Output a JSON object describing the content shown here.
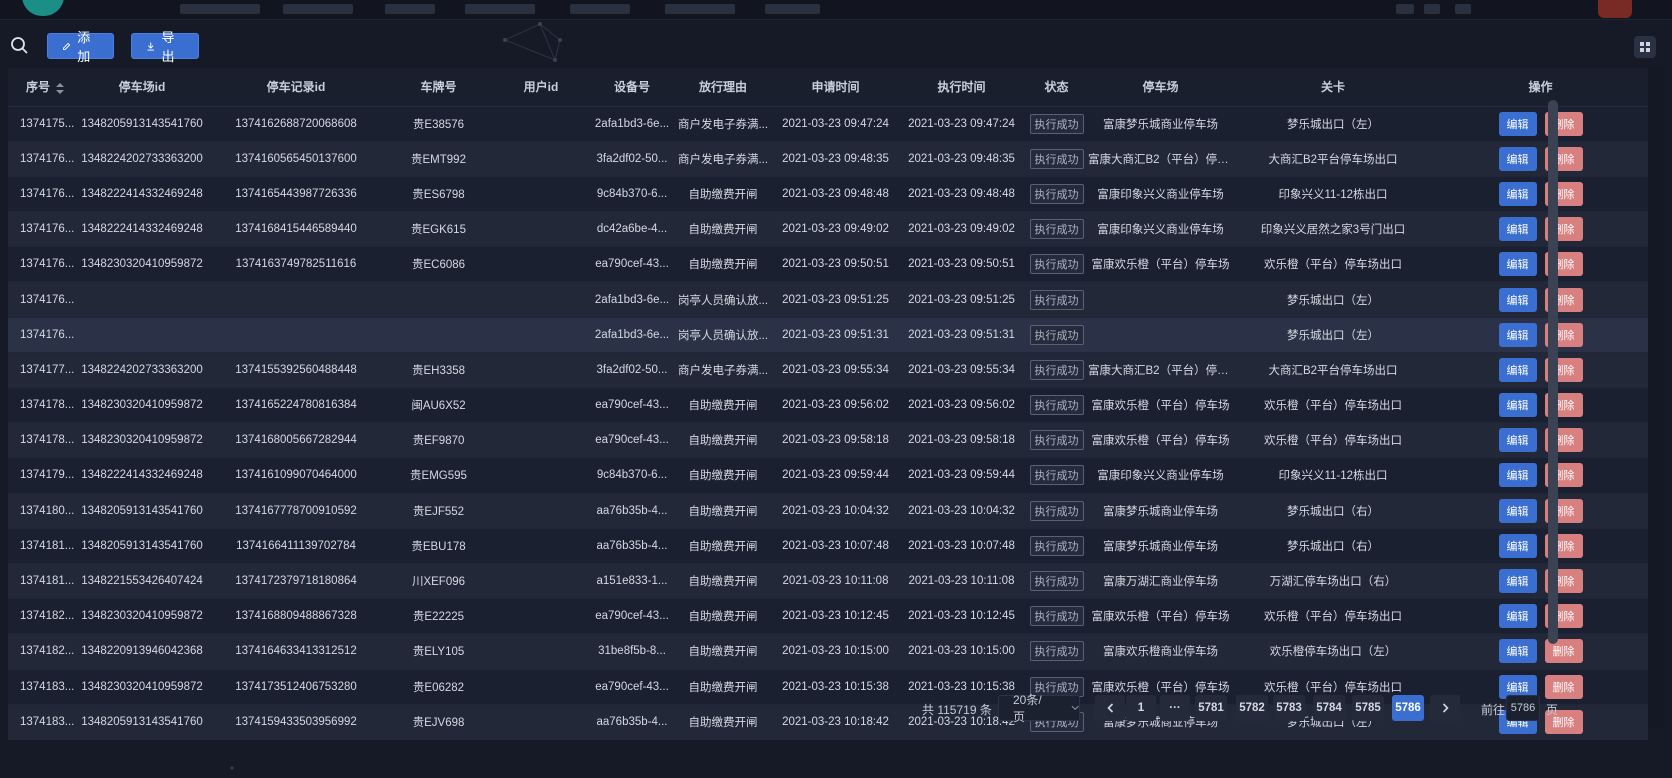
{
  "toolbar": {
    "add_label": "添加",
    "export_label": "导出"
  },
  "columns": [
    "序号",
    "停车场id",
    "停车记录id",
    "车牌号",
    "用户id",
    "设备号",
    "放行理由",
    "申请时间",
    "执行时间",
    "状态",
    "停车场",
    "关卡",
    "操作"
  ],
  "row_actions": {
    "edit": "编辑",
    "delete": "删除"
  },
  "rows": [
    [
      "1374175...",
      "1348205913143541760",
      "1374162688720068608",
      "贵E38576",
      "",
      "2afa1bd3-6e...",
      "商户发电子券满...",
      "2021-03-23 09:47:24",
      "2021-03-23 09:47:24",
      "执行成功",
      "富康梦乐城商业停车场",
      "梦乐城出口（左）"
    ],
    [
      "1374176...",
      "1348224202733363200",
      "1374160565450137600",
      "贵EMT992",
      "",
      "3fa2df02-50...",
      "商户发电子券满...",
      "2021-03-23 09:48:35",
      "2021-03-23 09:48:35",
      "执行成功",
      "富康大商汇B2（平台）停车场",
      "大商汇B2平台停车场出口"
    ],
    [
      "1374176...",
      "1348222414332469248",
      "1374165443987726336",
      "贵ES6798",
      "",
      "9c84b370-6...",
      "自助缴费开闸",
      "2021-03-23 09:48:48",
      "2021-03-23 09:48:48",
      "执行成功",
      "富康印象兴义商业停车场",
      "印象兴义11-12栋出口"
    ],
    [
      "1374176...",
      "1348222414332469248",
      "1374168415446589440",
      "贵EGK615",
      "",
      "dc42a6be-4...",
      "自助缴费开闸",
      "2021-03-23 09:49:02",
      "2021-03-23 09:49:02",
      "执行成功",
      "富康印象兴义商业停车场",
      "印象兴义居然之家3号门出口"
    ],
    [
      "1374176...",
      "1348230320410959872",
      "1374163749782511616",
      "贵EC6086",
      "",
      "ea790cef-43...",
      "自助缴费开闸",
      "2021-03-23 09:50:51",
      "2021-03-23 09:50:51",
      "执行成功",
      "富康欢乐橙（平台）停车场",
      "欢乐橙（平台）停车场出口"
    ],
    [
      "1374176...",
      "",
      "",
      "",
      "",
      "2afa1bd3-6e...",
      "岗亭人员确认放...",
      "2021-03-23 09:51:25",
      "2021-03-23 09:51:25",
      "执行成功",
      "",
      "梦乐城出口（左）"
    ],
    [
      "1374176...",
      "",
      "",
      "",
      "",
      "2afa1bd3-6e...",
      "岗亭人员确认放...",
      "2021-03-23 09:51:31",
      "2021-03-23 09:51:31",
      "执行成功",
      "",
      "梦乐城出口（左）"
    ],
    [
      "1374177...",
      "1348224202733363200",
      "1374155392560488448",
      "贵EH3358",
      "",
      "3fa2df02-50...",
      "商户发电子券满...",
      "2021-03-23 09:55:34",
      "2021-03-23 09:55:34",
      "执行成功",
      "富康大商汇B2（平台）停车场",
      "大商汇B2平台停车场出口"
    ],
    [
      "1374178...",
      "1348230320410959872",
      "1374165224780816384",
      "闽AU6X52",
      "",
      "ea790cef-43...",
      "自助缴费开闸",
      "2021-03-23 09:56:02",
      "2021-03-23 09:56:02",
      "执行成功",
      "富康欢乐橙（平台）停车场",
      "欢乐橙（平台）停车场出口"
    ],
    [
      "1374178...",
      "1348230320410959872",
      "1374168005667282944",
      "贵EF9870",
      "",
      "ea790cef-43...",
      "自助缴费开闸",
      "2021-03-23 09:58:18",
      "2021-03-23 09:58:18",
      "执行成功",
      "富康欢乐橙（平台）停车场",
      "欢乐橙（平台）停车场出口"
    ],
    [
      "1374179...",
      "1348222414332469248",
      "1374161099070464000",
      "贵EMG595",
      "",
      "9c84b370-6...",
      "自助缴费开闸",
      "2021-03-23 09:59:44",
      "2021-03-23 09:59:44",
      "执行成功",
      "富康印象兴义商业停车场",
      "印象兴义11-12栋出口"
    ],
    [
      "1374180...",
      "1348205913143541760",
      "1374167778700910592",
      "贵EJF552",
      "",
      "aa76b35b-4...",
      "自助缴费开闸",
      "2021-03-23 10:04:32",
      "2021-03-23 10:04:32",
      "执行成功",
      "富康梦乐城商业停车场",
      "梦乐城出口（右）"
    ],
    [
      "1374181...",
      "1348205913143541760",
      "1374166411139702784",
      "贵EBU178",
      "",
      "aa76b35b-4...",
      "自助缴费开闸",
      "2021-03-23 10:07:48",
      "2021-03-23 10:07:48",
      "执行成功",
      "富康梦乐城商业停车场",
      "梦乐城出口（右）"
    ],
    [
      "1374181...",
      "1348221553426407424",
      "1374172379718180864",
      "川XEF096",
      "",
      "a151e833-1...",
      "自助缴费开闸",
      "2021-03-23 10:11:08",
      "2021-03-23 10:11:08",
      "执行成功",
      "富康万湖汇商业停车场",
      "万湖汇停车场出口（右）"
    ],
    [
      "1374182...",
      "1348230320410959872",
      "1374168809488867328",
      "贵E22225",
      "",
      "ea790cef-43...",
      "自助缴费开闸",
      "2021-03-23 10:12:45",
      "2021-03-23 10:12:45",
      "执行成功",
      "富康欢乐橙（平台）停车场",
      "欢乐橙（平台）停车场出口"
    ],
    [
      "1374182...",
      "1348220913946042368",
      "1374164633413312512",
      "贵ELY105",
      "",
      "31be8f5b-8...",
      "自助缴费开闸",
      "2021-03-23 10:15:00",
      "2021-03-23 10:15:00",
      "执行成功",
      "富康欢乐橙商业停车场",
      "欢乐橙停车场出口（左）"
    ],
    [
      "1374183...",
      "1348230320410959872",
      "1374173512406753280",
      "贵E06282",
      "",
      "ea790cef-43...",
      "自助缴费开闸",
      "2021-03-23 10:15:38",
      "2021-03-23 10:15:38",
      "执行成功",
      "富康欢乐橙（平台）停车场",
      "欢乐橙（平台）停车场出口"
    ],
    [
      "1374183...",
      "1348205913143541760",
      "1374159433503956992",
      "贵EJV698",
      "",
      "aa76b35b-4...",
      "自助缴费开闸",
      "2021-03-23 10:18:42",
      "2021-03-23 10:18:42",
      "执行成功",
      "富康梦乐城商业停车场",
      "梦乐城出口（左）"
    ]
  ],
  "pagination": {
    "total_text": "共 115719 条",
    "page_size": "20条/页",
    "first_page": "1",
    "ellipsis": "···",
    "pages": [
      "5781",
      "5782",
      "5783",
      "5784",
      "5785",
      "5786"
    ],
    "current_page": "5786",
    "goto_label": "前往",
    "goto_value": "5786",
    "goto_suffix": "页"
  },
  "colors": {
    "primary": "#3a6fd1",
    "danger": "#d87f80",
    "background": "#161a26"
  }
}
